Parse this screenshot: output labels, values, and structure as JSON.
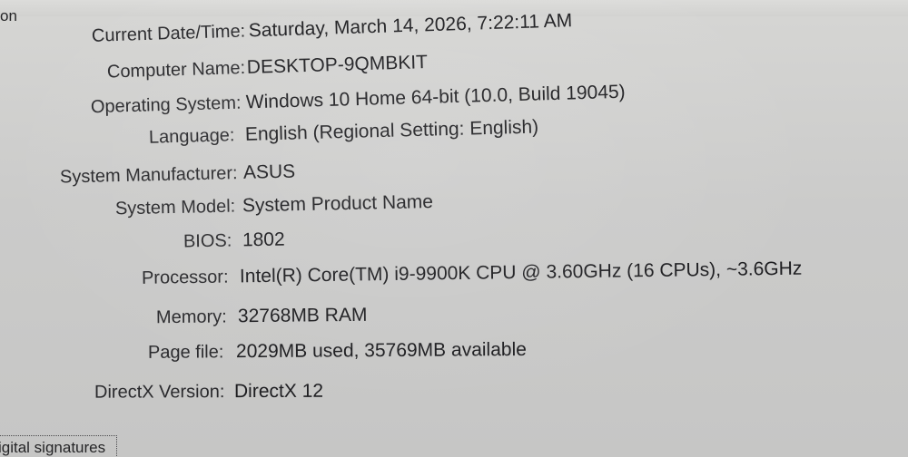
{
  "group_title_fragment": "on",
  "system_info": [
    {
      "label": "Current Date/Time:",
      "value": "Saturday, March 14, 2026, 7:22:11 AM"
    },
    {
      "label": "Computer Name:",
      "value": "DESKTOP-9QMBKIT"
    },
    {
      "label": "Operating System:",
      "value": "Windows 10 Home 64-bit (10.0, Build 19045)"
    },
    {
      "label": "Language:",
      "value": "English (Regional Setting: English)"
    },
    {
      "label": "System Manufacturer:",
      "value": "ASUS"
    },
    {
      "label": "System Model:",
      "value": "System Product Name"
    },
    {
      "label": "BIOS:",
      "value": "1802"
    },
    {
      "label": "Processor:",
      "value": "Intel(R) Core(TM) i9-9900K CPU @ 3.60GHz (16 CPUs), ~3.6GHz"
    },
    {
      "label": "Memory:",
      "value": "32768MB RAM"
    },
    {
      "label": "Page file:",
      "value": "2029MB used, 35769MB available"
    },
    {
      "label": "DirectX Version:",
      "value": "DirectX 12"
    }
  ],
  "digital_signature_fragment": "igital signatures"
}
